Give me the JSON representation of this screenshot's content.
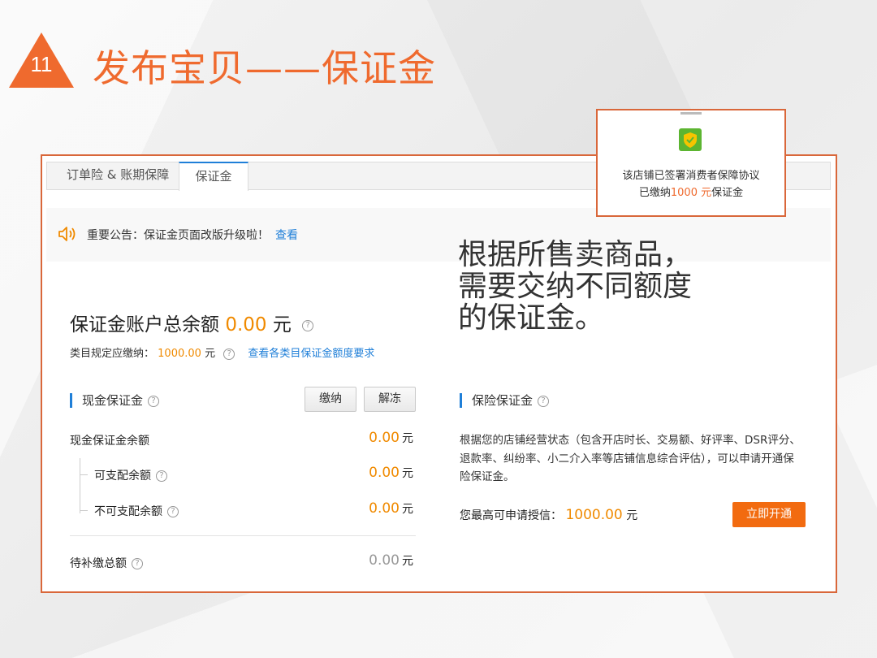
{
  "slide": {
    "number": "11",
    "title": "发布宝贝——保证金"
  },
  "tabs": [
    {
      "label": "订单险 & 账期保障"
    },
    {
      "label": "保证金"
    }
  ],
  "notice": {
    "text": "重要公告：保证金页面改版升级啦！",
    "link": "查看"
  },
  "balance": {
    "label": "保证金账户总余额",
    "amount": "0.00",
    "unit": "元",
    "required_label": "类目规定应缴纳：",
    "required_amount": "1000.00",
    "required_unit": "元",
    "required_link": "查看各类目保证金额度要求"
  },
  "cash": {
    "title": "现金保证金",
    "pay_button": "缴纳",
    "unfreeze_button": "解冻",
    "rows": [
      {
        "label": "现金保证金余额",
        "value": "0.00",
        "unit": "元"
      },
      {
        "label": "可支配余额",
        "value": "0.00",
        "unit": "元"
      },
      {
        "label": "不可支配余额",
        "value": "0.00",
        "unit": "元"
      }
    ],
    "pending": {
      "label": "待补缴总额",
      "value": "0.00",
      "unit": "元"
    }
  },
  "insurance": {
    "title": "保险保证金",
    "description": "根据您的店铺经营状态（包含开店时长、交易额、好评率、DSR评分、退款率、纠纷率、小二介入率等店铺信息综合评估），可以申请开通保险保证金。",
    "credit_label": "您最高可申请授信：",
    "credit_amount": "1000.00",
    "credit_unit": "元",
    "open_button": "立即开通"
  },
  "callout": {
    "line1": "该店铺已签署消费者保障协议",
    "line2_prefix": "已缴纳",
    "line2_amount": "1000 元",
    "line2_suffix": "保证金"
  },
  "overlay": {
    "line1": "根据所售卖商品，",
    "line2": "需要交纳不同额度",
    "line3": "的保证金。"
  },
  "colors": {
    "accent": "#ef6a2e",
    "frame_border": "#d9673a",
    "amount_orange": "#f08a00",
    "link_blue": "#1f7fd8",
    "button_orange": "#f26b10"
  }
}
